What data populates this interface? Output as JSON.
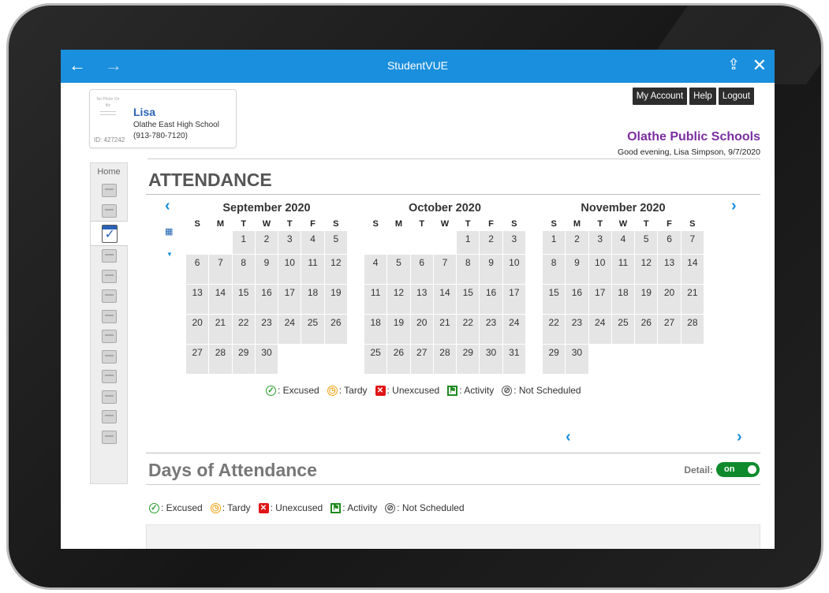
{
  "app": {
    "title": "StudentVUE"
  },
  "student": {
    "name": "Lisa",
    "school": "Olathe East High School",
    "phone": "(913-780-7120)",
    "id": "ID: 427242",
    "photo_text": "No Photo On file"
  },
  "header": {
    "buttons": [
      "My Account",
      "Help",
      "Logout"
    ],
    "district": "Olathe Public Schools",
    "greeting": "Good evening, Lisa Simpson, 9/7/2020"
  },
  "nav": {
    "home": "Home",
    "items": [
      "mail-icon",
      "grade-book-icon",
      "attendance-icon",
      "class-schedule-icon",
      "report-card-icon",
      "course-history-icon",
      "test-history-icon",
      "grades-icon",
      "school-info-icon",
      "student-info-icon",
      "parent-info-icon",
      "lock-icon",
      "health-icon"
    ]
  },
  "attendance": {
    "title": "ATTENDANCE",
    "day_headers": [
      "S",
      "M",
      "T",
      "W",
      "T",
      "F",
      "S"
    ],
    "months": [
      {
        "title": "September 2020",
        "start": 2,
        "days": 30
      },
      {
        "title": "October 2020",
        "start": 4,
        "days": 31
      },
      {
        "title": "November 2020",
        "start": 0,
        "days": 30
      }
    ]
  },
  "legend": {
    "excused": ": Excused",
    "tardy": ": Tardy",
    "unexcused": ": Unexcused",
    "activity": ": Activity",
    "not_scheduled": ": Not Scheduled"
  },
  "days_of_attendance": {
    "title": "Days of Attendance",
    "detail_label": "Detail:",
    "toggle": "on"
  },
  "colors": {
    "topbar": "#1a8fdd",
    "district": "#7a2ea0",
    "excused": "#2a9a2a",
    "tardy": "#f2a418",
    "unexcused": "#e01515",
    "activity": "#1f8a1f",
    "toggle": "#0e8a2c"
  }
}
